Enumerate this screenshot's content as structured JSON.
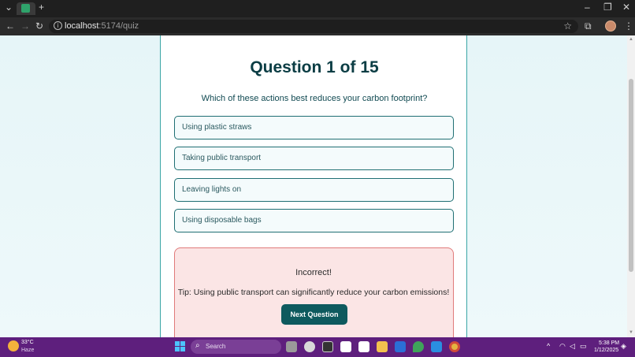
{
  "browser": {
    "url_host": "localhost",
    "url_path": ":5174/quiz"
  },
  "quiz": {
    "title": "Question 1 of 15",
    "question": "Which of these actions best reduces your carbon footprint?",
    "options": [
      "Using plastic straws",
      "Taking public transport",
      "Leaving lights on",
      "Using disposable bags"
    ],
    "feedback": {
      "result": "Incorrect!",
      "tip": "Tip: Using public transport can significantly reduce your carbon emissions!",
      "next_label": "Next Question"
    }
  },
  "taskbar": {
    "weather_temp": "33°C",
    "weather_desc": "Haze",
    "search_label": "Search",
    "time": "5:38 PM",
    "date": "1/12/2025"
  },
  "colors": {
    "accent": "#0e5a5e",
    "title": "#0b3d44",
    "error_bg": "#fbe5e5",
    "error_border": "#e07a7a",
    "taskbar": "#5e1f7d"
  }
}
